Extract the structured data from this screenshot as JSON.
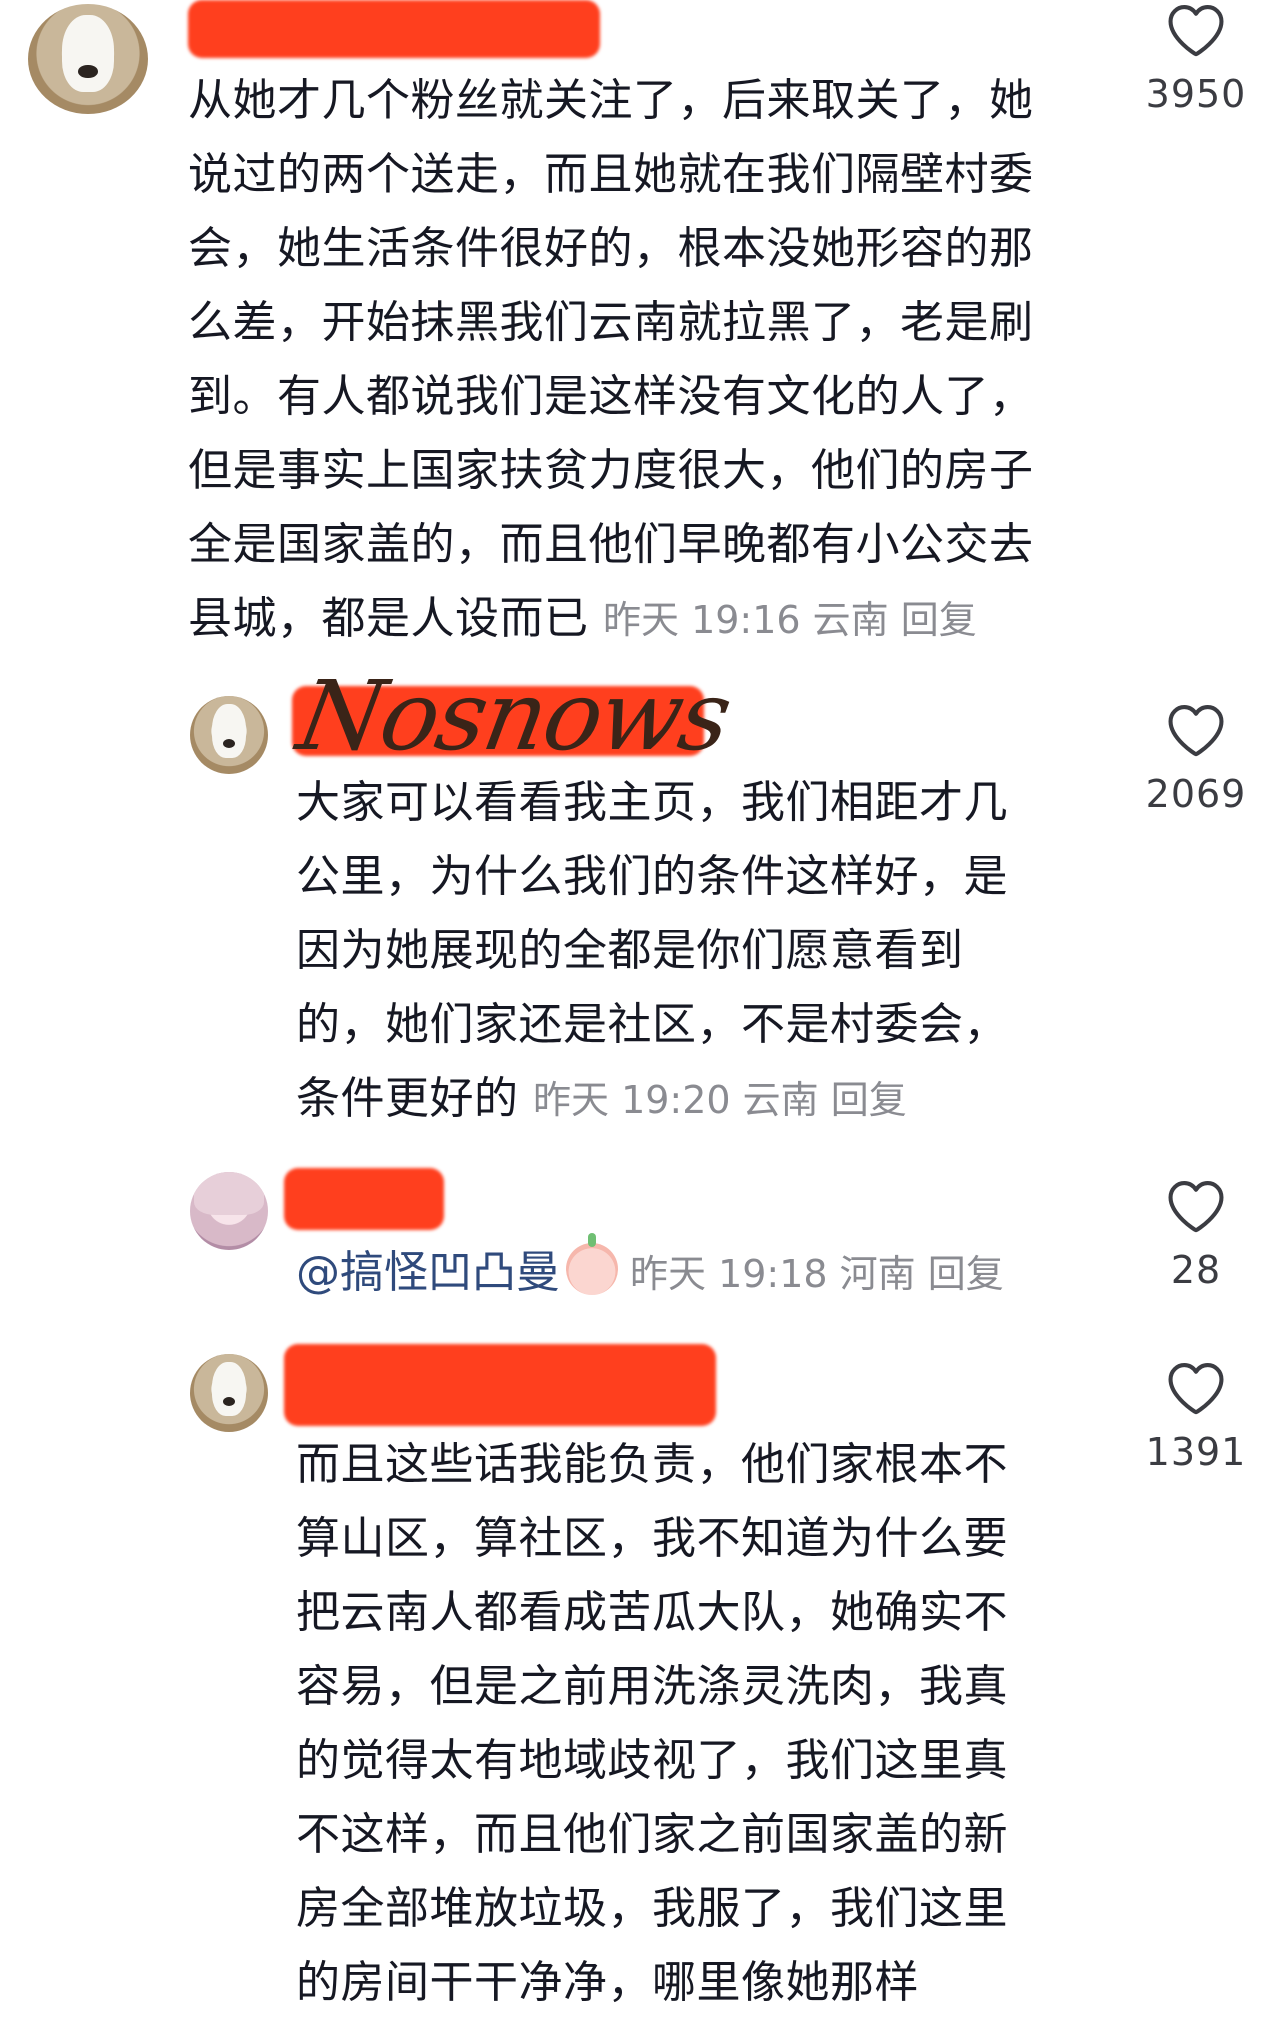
{
  "comments": [
    {
      "text_lines": [
        "从她才几个粉丝就关注了，后来取关了，她",
        "说过的两个送走，而且她就在我们隔壁村委",
        "会，她生活条件很好的，根本没她形容的那",
        "么差，开始抹黑我们云南就拉黑了，老是刷",
        "到。有人都说我们是这样没有文化的人了，",
        "但是事实上国家扶贫力度很大，他们的房子",
        "全是国家盖的，而且他们早晚都有小公交去"
      ],
      "last_line_text": "县城，都是人设而已",
      "meta": "昨天 19:16 云南 回复",
      "likes": "3950"
    },
    {
      "text_lines": [
        "大家可以看看我主页，我们相距才几",
        "公里，为什么我们的条件这样好，是",
        "因为她展现的全都是你们愿意看到",
        "的，她们家还是社区，不是村委会，"
      ],
      "last_line_text": "条件更好的",
      "meta": "昨天 19:20 云南 回复",
      "likes": "2069"
    },
    {
      "mention": "@搞怪凹凸曼",
      "meta": "昨天 19:18 河南 回复",
      "likes": "28"
    },
    {
      "text_lines": [
        "而且这些话我能负责，他们家根本不",
        "算山区，算社区，我不知道为什么要",
        "把云南人都看成苦瓜大队，她确实不",
        "容易，但是之前用洗涤灵洗肉，我真",
        "的觉得太有地域歧视了，我们这里真",
        "不这样，而且他们家之前国家盖的新",
        "房全部堆放垃圾，我服了，我们这里",
        "的房间干干净净，哪里像她那样"
      ],
      "likes": "1391"
    }
  ],
  "watermark": "Nosnows",
  "colors": {
    "text": "#161823",
    "meta": "#8a8b91",
    "redaction": "#ff3f1e",
    "mention": "#2f4a7c"
  },
  "icons": {
    "like": "heart-outline-icon"
  }
}
